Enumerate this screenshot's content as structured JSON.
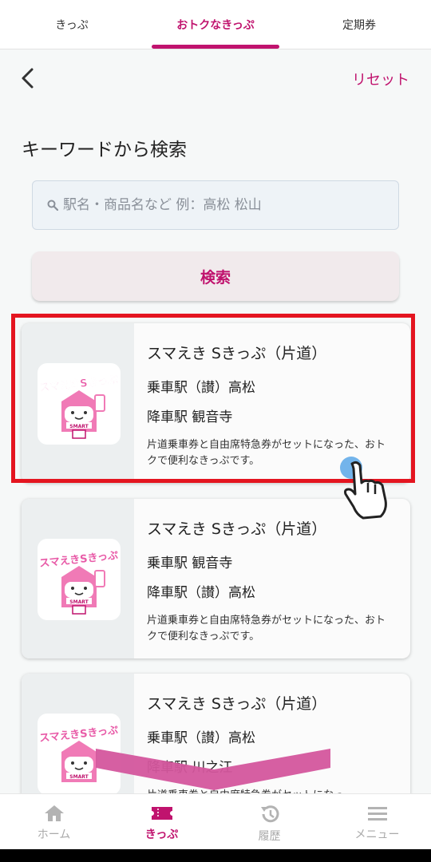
{
  "tabs": [
    "きっぷ",
    "おトクなきっぷ",
    "定期券"
  ],
  "header": {
    "reset_label": "リセット"
  },
  "search": {
    "title": "キーワードから検索",
    "placeholder": "駅名・商品名など 例：高松 松山",
    "button_label": "検索"
  },
  "results": [
    {
      "title": "スマえき Sきっぷ（片道）",
      "boarding": "乗車駅（讃）高松",
      "alighting": "降車駅 観音寺",
      "description": "片道乗車券と自由席特急券がセットになった、おトクで便利なきっぷです。",
      "logo_text": "スマえきSきっぷ"
    },
    {
      "title": "スマえき Sきっぷ（片道）",
      "boarding": "乗車駅 観音寺",
      "alighting": "降車駅（讃）高松",
      "description": "片道乗車券と自由席特急券がセットになった、おトクで便利なきっぷです。",
      "logo_text": "スマえきSきっぷ"
    },
    {
      "title": "スマえき Sきっぷ（片道）",
      "boarding": "乗車駅（讃）高松",
      "alighting": "降車駅 川之江",
      "description": "片道乗車券と自由席特急券がセットになっ",
      "logo_text": "スマえきSきっぷ"
    }
  ],
  "logo_badge": "SMART",
  "nav": [
    "ホーム",
    "きっぷ",
    "履歴",
    "メニュー"
  ],
  "colors": {
    "accent": "#c0136e",
    "highlight": "#e41520",
    "tap": "#5aa7e8"
  }
}
